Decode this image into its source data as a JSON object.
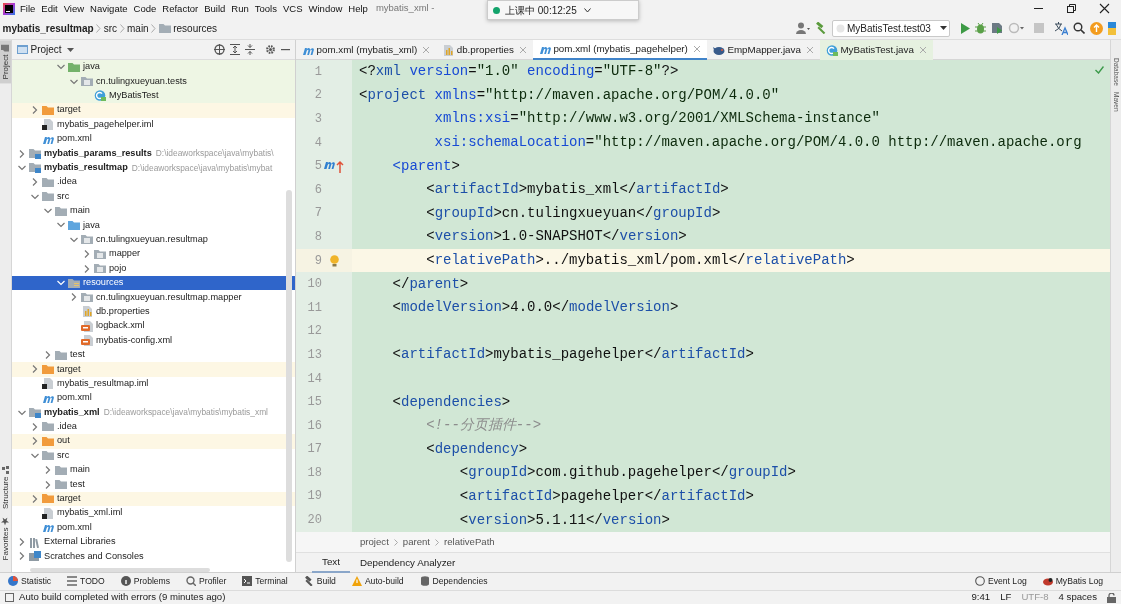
{
  "menu_bar": {
    "items": [
      "File",
      "Edit",
      "View",
      "Navigate",
      "Code",
      "Refactor",
      "Build",
      "Run",
      "Tools",
      "VCS",
      "Window",
      "Help"
    ],
    "title": "mybatis_xml -"
  },
  "recording": {
    "status": "上课中 00:12:25"
  },
  "navigation_bar": {
    "breadcrumb": [
      "mybatis_resultmap",
      "src",
      "main",
      "resources"
    ],
    "run_configuration": "MyBatisTest.test03"
  },
  "left_stripe": [
    {
      "label": "Project",
      "selected": true,
      "kind": "project"
    },
    {
      "label": "Structure",
      "selected": false,
      "kind": "structure"
    },
    {
      "label": "Favorites",
      "selected": false,
      "kind": "favorites"
    }
  ],
  "right_stripe": [
    "Database",
    "Maven"
  ],
  "project_panel": {
    "title": "Project",
    "tree": [
      {
        "children": [
          {
            "children": [
              {
                "children": [
                  {
                    "label": "java",
                    "kind": "folder-test",
                    "expanded": true,
                    "selected": false,
                    "children": [
                      {
                        "label": "cn.tulingxueyuan.tests",
                        "kind": "package-test",
                        "expanded": true,
                        "selected": false,
                        "children": [
                          {
                            "label": "MyBatisTest",
                            "kind": "class-test",
                            "selected": false
                          }
                        ]
                      }
                    ]
                  }
                ]
              }
            ]
          },
          {
            "label": "target",
            "kind": "folder-excluded",
            "expanded": false,
            "selected": false
          },
          {
            "label": "mybatis_pagehelper.iml",
            "kind": "iml",
            "selected": false
          },
          {
            "label": "pom.xml",
            "kind": "maven",
            "selected": false
          }
        ]
      },
      {
        "label": "mybatis_params_results",
        "kind": "module",
        "path": "D:\\ideaworkspace\\java\\mybatis\\",
        "expanded": false,
        "selected": false
      },
      {
        "label": "mybatis_resultmap",
        "kind": "module",
        "path": "D:\\ideaworkspace\\java\\mybatis\\mybat",
        "expanded": true,
        "selected": false,
        "children": [
          {
            "label": ".idea",
            "kind": "folder",
            "expanded": false,
            "selected": false
          },
          {
            "label": "src",
            "kind": "folder",
            "expanded": true,
            "selected": false,
            "children": [
              {
                "label": "main",
                "kind": "folder",
                "expanded": true,
                "selected": false,
                "children": [
                  {
                    "label": "java",
                    "kind": "folder-source",
                    "expanded": true,
                    "selected": false,
                    "children": [
                      {
                        "label": "cn.tulingxueyuan.resultmap",
                        "kind": "package",
                        "expanded": true,
                        "selected": false,
                        "children": [
                          {
                            "label": "mapper",
                            "kind": "package",
                            "expanded": false,
                            "selected": false
                          },
                          {
                            "label": "pojo",
                            "kind": "package",
                            "expanded": false,
                            "selected": false
                          }
                        ]
                      }
                    ]
                  },
                  {
                    "label": "resources",
                    "kind": "folder-resources",
                    "expanded": true,
                    "selected": true,
                    "children": [
                      {
                        "label": "cn.tulingxueyuan.resultmap.mapper",
                        "kind": "package",
                        "expanded": false,
                        "selected": false
                      },
                      {
                        "label": "db.properties",
                        "kind": "properties",
                        "selected": false
                      },
                      {
                        "label": "logback.xml",
                        "kind": "xml",
                        "selected": false
                      },
                      {
                        "label": "mybatis-config.xml",
                        "kind": "xml",
                        "selected": false
                      }
                    ]
                  }
                ]
              },
              {
                "label": "test",
                "kind": "folder",
                "expanded": false,
                "selected": false
              }
            ]
          },
          {
            "label": "target",
            "kind": "folder-excluded",
            "expanded": false,
            "selected": false
          },
          {
            "label": "mybatis_resultmap.iml",
            "kind": "iml",
            "selected": false
          },
          {
            "label": "pom.xml",
            "kind": "maven",
            "selected": false
          }
        ]
      },
      {
        "label": "mybatis_xml",
        "kind": "module",
        "path": "D:\\ideaworkspace\\java\\mybatis\\mybatis_xml",
        "expanded": true,
        "selected": false,
        "children": [
          {
            "label": ".idea",
            "kind": "folder",
            "expanded": false,
            "selected": false
          },
          {
            "label": "out",
            "kind": "folder-excluded",
            "expanded": false,
            "selected": false
          },
          {
            "label": "src",
            "kind": "folder",
            "expanded": true,
            "selected": false,
            "children": [
              {
                "label": "main",
                "kind": "folder",
                "expanded": false,
                "selected": false
              },
              {
                "label": "test",
                "kind": "folder",
                "expanded": false,
                "selected": false
              }
            ]
          },
          {
            "label": "target",
            "kind": "folder-excluded",
            "expanded": false,
            "selected": false
          },
          {
            "label": "mybatis_xml.iml",
            "kind": "iml",
            "selected": false
          },
          {
            "label": "pom.xml",
            "kind": "maven",
            "selected": false
          }
        ]
      },
      {
        "label": "External Libraries",
        "kind": "libraries",
        "expanded": false,
        "selected": false
      },
      {
        "label": "Scratches and Consoles",
        "kind": "scratches",
        "expanded": false,
        "selected": false
      }
    ]
  },
  "editor": {
    "tabs": [
      {
        "label": "pom.xml (mybatis_xml)",
        "kind": "maven",
        "selected": false
      },
      {
        "label": "db.properties",
        "kind": "properties",
        "selected": false
      },
      {
        "label": "pom.xml (mybatis_pagehelper)",
        "kind": "maven",
        "selected": true
      },
      {
        "label": "EmpMapper.java",
        "kind": "mapper",
        "selected": false
      },
      {
        "label": "MyBatisTest.java",
        "kind": "class-test",
        "selected": false
      }
    ],
    "lines": [
      {
        "number": "1",
        "text": "<?xml version=\"1.0\" encoding=\"UTF-8\"?>",
        "current": false
      },
      {
        "number": "2",
        "text": "<project xmlns=\"http://maven.apache.org/POM/4.0.0\"",
        "current": false
      },
      {
        "number": "3",
        "text": "         xmlns:xsi=\"http://www.w3.org/2001/XMLSchema-instance\"",
        "current": false
      },
      {
        "number": "4",
        "text": "         xsi:schemaLocation=\"http://maven.apache.org/POM/4.0.0 http://maven.apache.org",
        "current": false
      },
      {
        "number": "5",
        "text": "    <parent>",
        "current": false,
        "kind": "parent-link"
      },
      {
        "number": "6",
        "text": "        <artifactId>mybatis_xml</artifactId>",
        "current": false
      },
      {
        "number": "7",
        "text": "        <groupId>cn.tulingxueyuan</groupId>",
        "current": false
      },
      {
        "number": "8",
        "text": "        <version>1.0-SNAPSHOT</version>",
        "current": false
      },
      {
        "number": "9",
        "text": "        <relativePath>../mybatis_xml/pom.xml</relativePath>",
        "current": true,
        "kind": "intention"
      },
      {
        "number": "10",
        "text": "    </parent>",
        "current": false
      },
      {
        "number": "11",
        "text": "    <modelVersion>4.0.0</modelVersion>",
        "current": false
      },
      {
        "number": "12",
        "current": false
      },
      {
        "number": "13",
        "text": "    <artifactId>mybatis_pagehelper</artifactId>",
        "current": false
      },
      {
        "number": "14",
        "current": false
      },
      {
        "number": "15",
        "text": "    <dependencies>",
        "current": false
      },
      {
        "number": "16",
        "text": "        <!--分页插件-->",
        "current": false
      },
      {
        "number": "17",
        "text": "        <dependency>",
        "current": false
      },
      {
        "number": "18",
        "text": "            <groupId>com.github.pagehelper</groupId>",
        "current": false
      },
      {
        "number": "19",
        "text": "            <artifactId>pagehelper</artifactId>",
        "current": false
      },
      {
        "number": "20",
        "text": "            <version>5.1.11</version>",
        "current": false
      }
    ],
    "breadcrumb": [
      "project",
      "parent",
      "relativePath"
    ],
    "view_tabs": [
      {
        "label": "Text",
        "selected": true
      },
      {
        "label": "Dependency Analyzer",
        "selected": false
      }
    ]
  },
  "tool_bar": {
    "left": [
      {
        "label": "Statistic",
        "kind": "statistic"
      },
      {
        "label": "TODO",
        "kind": "todo"
      },
      {
        "label": "Problems",
        "kind": "problems"
      },
      {
        "label": "Profiler",
        "kind": "profiler"
      },
      {
        "label": "Terminal",
        "kind": "terminal"
      },
      {
        "label": "Build",
        "kind": "build"
      },
      {
        "label": "Auto-build",
        "kind": "warning"
      },
      {
        "label": "Dependencies",
        "kind": "dependencies"
      }
    ],
    "right": [
      {
        "label": "Event Log",
        "kind": "event-log"
      },
      {
        "label": "MyBatis Log",
        "kind": "bird"
      }
    ]
  },
  "status_bar": {
    "message": "Auto build completed with errors (9 minutes ago)",
    "position": "9:41",
    "line_separator": "LF",
    "encoding": "UTF-8",
    "indent": "4 spaces"
  }
}
